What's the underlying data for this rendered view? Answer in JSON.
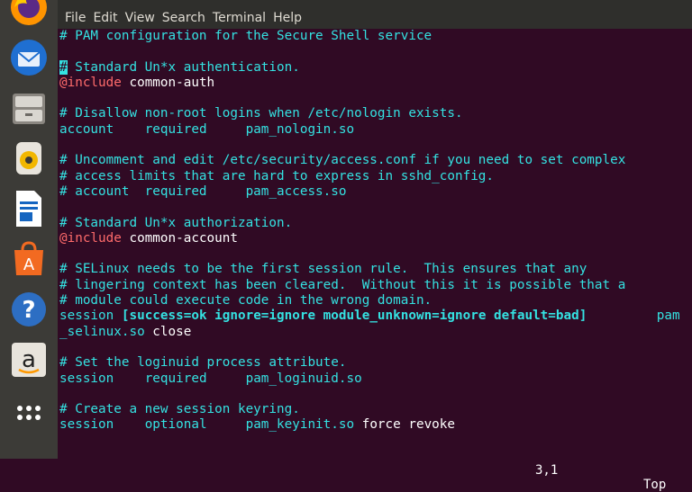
{
  "menu": {
    "items": [
      "File",
      "Edit",
      "View",
      "Search",
      "Terminal",
      "Help"
    ]
  },
  "dock": {
    "apps": [
      "firefox-icon",
      "thunderbird-icon",
      "files-icon",
      "rhythmbox-icon",
      "writer-icon",
      "software-icon",
      "help-icon",
      "amazon-icon",
      "show-apps-icon"
    ]
  },
  "editor": {
    "lines": [
      {
        "cls": "cmt",
        "text": "# PAM configuration for the Secure Shell service"
      },
      {
        "cls": "",
        "text": ""
      },
      {
        "cls": "cmt",
        "text": "# Standard Un*x authentication.",
        "cursor": true
      },
      {
        "cls": "inc",
        "kw": "@include",
        "rest": " common-auth"
      },
      {
        "cls": "",
        "text": ""
      },
      {
        "cls": "cmt",
        "text": "# Disallow non-root logins when /etc/nologin exists."
      },
      {
        "cls": "cfg",
        "a": "account",
        "b": "required",
        "c": "pam_nologin.so"
      },
      {
        "cls": "",
        "text": ""
      },
      {
        "cls": "cmt",
        "text": "# Uncomment and edit /etc/security/access.conf if you need to set complex"
      },
      {
        "cls": "cmt",
        "text": "# access limits that are hard to express in sshd_config."
      },
      {
        "cls": "cmt",
        "text": "# account  required     pam_access.so"
      },
      {
        "cls": "",
        "text": ""
      },
      {
        "cls": "cmt",
        "text": "# Standard Un*x authorization."
      },
      {
        "cls": "inc",
        "kw": "@include",
        "rest": " common-account"
      },
      {
        "cls": "",
        "text": ""
      },
      {
        "cls": "cmt",
        "text": "# SELinux needs to be the first session rule.  This ensures that any"
      },
      {
        "cls": "cmt",
        "text": "# lingering context has been cleared.  Without this it is possible that a"
      },
      {
        "cls": "cmt",
        "text": "# module could execute code in the wrong domain."
      },
      {
        "cls": "sel",
        "text": "session ",
        "bold": "[success=ok ignore=ignore module_unknown=ignore default=bad]",
        "tail": "         pam"
      },
      {
        "cls": "",
        "text": "_selinux.so close"
      },
      {
        "cls": "",
        "text": ""
      },
      {
        "cls": "cmt",
        "text": "# Set the loginuid process attribute."
      },
      {
        "cls": "cfg",
        "a": "session",
        "b": "required",
        "c": "pam_loginuid.so"
      },
      {
        "cls": "",
        "text": ""
      },
      {
        "cls": "cmt",
        "text": "# Create a new session keyring."
      },
      {
        "cls": "cfg",
        "a": "session",
        "b": "optional",
        "c": "pam_keyinit.so",
        "d": " force revoke"
      }
    ],
    "status_pos": "3,1",
    "status_scroll": "Top"
  }
}
